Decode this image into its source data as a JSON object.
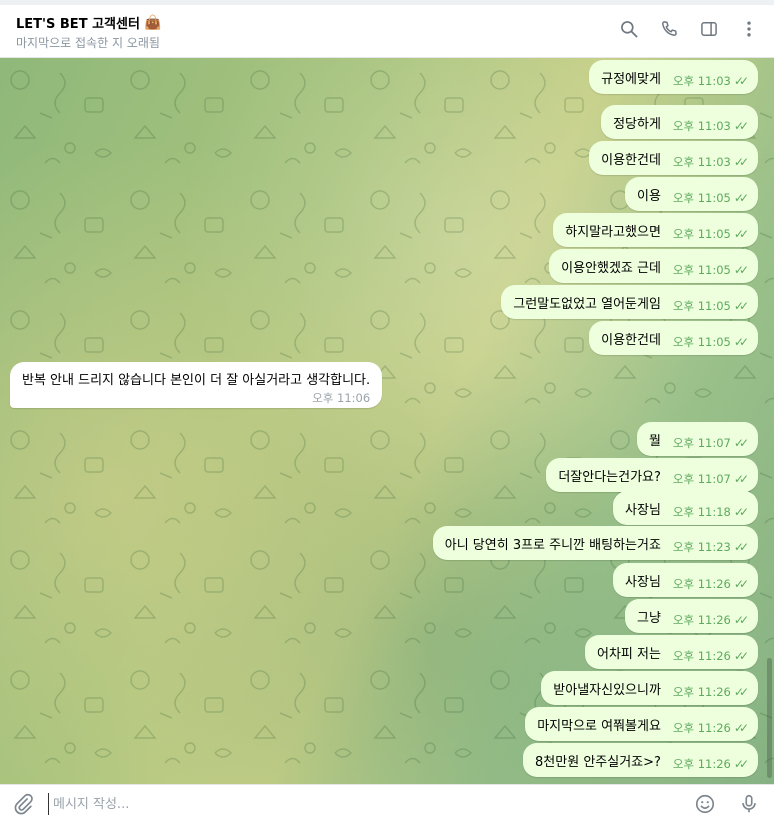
{
  "header": {
    "title": "LET'S BET 고객센터",
    "title_icon": "shopping-bag-emoji",
    "status": "마지막으로 접속한 지 오래됨",
    "icons": [
      "search-icon",
      "phone-icon",
      "sidebar-toggle-icon",
      "more-vert-icon"
    ]
  },
  "messages": [
    {
      "text": "규정에맞게",
      "time": "오후 11:03",
      "direction": "out"
    },
    {
      "text": "정당하게",
      "time": "오후 11:03",
      "direction": "out"
    },
    {
      "text": "이용한건데",
      "time": "오후 11:03",
      "direction": "out"
    },
    {
      "text": "이용",
      "time": "오후 11:05",
      "direction": "out"
    },
    {
      "text": "하지말라고했으면",
      "time": "오후 11:05",
      "direction": "out"
    },
    {
      "text": "이용안했겠죠 근데",
      "time": "오후 11:05",
      "direction": "out"
    },
    {
      "text": "그런말도없었고 열어둔게임",
      "time": "오후 11:05",
      "direction": "out"
    },
    {
      "text": "이용한건데",
      "time": "오후 11:05",
      "direction": "out"
    },
    {
      "text": "반복 안내 드리지 않습니다 본인이 더 잘 아실거라고 생각합니다.",
      "time": "오후 11:06",
      "direction": "in"
    },
    {
      "text": "뭘",
      "time": "오후 11:07",
      "direction": "out"
    },
    {
      "text": "더잘안다는건가요?",
      "time": "오후 11:07",
      "direction": "out"
    },
    {
      "text": "사장님",
      "time": "오후 11:18",
      "direction": "out"
    },
    {
      "text": "아니 당연히 3프로 주니깐 배팅하는거죠",
      "time": "오후 11:23",
      "direction": "out"
    },
    {
      "text": "사장님",
      "time": "오후 11:26",
      "direction": "out"
    },
    {
      "text": "그냥",
      "time": "오후 11:26",
      "direction": "out"
    },
    {
      "text": "어차피 저는",
      "time": "오후 11:26",
      "direction": "out"
    },
    {
      "text": "받아낼자신있으니까",
      "time": "오후 11:26",
      "direction": "out"
    },
    {
      "text": "마지막으로 여쭤볼게요",
      "time": "오후 11:26",
      "direction": "out"
    },
    {
      "text": "8천만원 안주실거죠>?",
      "time": "오후 11:26",
      "direction": "out"
    }
  ],
  "composer": {
    "placeholder": "메시지 작성...",
    "value": ""
  },
  "colors": {
    "outgoing_bubble": "#eeffde",
    "incoming_bubble": "#ffffff",
    "outgoing_time": "#5eaa5e"
  }
}
